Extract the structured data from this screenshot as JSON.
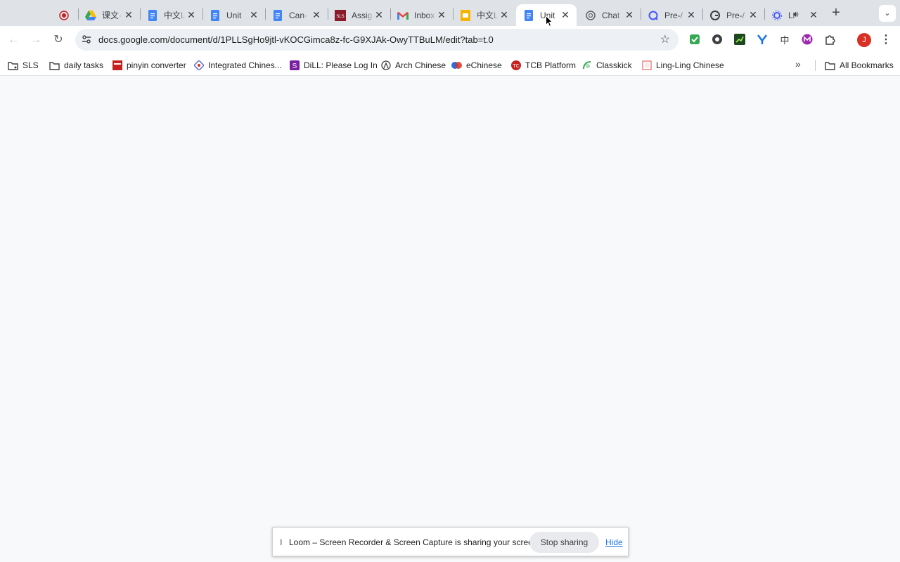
{
  "tabs": [
    {
      "title": "",
      "icon": "record-icon",
      "color": "#c5221f"
    },
    {
      "title": "课文·",
      "icon": "google-drive-icon"
    },
    {
      "title": "中文L",
      "icon": "google-docs-icon",
      "color": "#4285f4"
    },
    {
      "title": "Unit",
      "icon": "google-docs-icon",
      "color": "#4285f4"
    },
    {
      "title": "Can·",
      "icon": "google-docs-icon",
      "color": "#4285f4"
    },
    {
      "title": "Assig",
      "icon": "sls-icon",
      "color": "#8b1a2b"
    },
    {
      "title": "Inbox",
      "icon": "gmail-icon"
    },
    {
      "title": "中文L",
      "icon": "google-slides-icon",
      "color": "#f4b400"
    },
    {
      "title": "Unit",
      "icon": "google-docs-icon",
      "color": "#4285f4",
      "active": true
    },
    {
      "title": "Chat",
      "icon": "chatgpt-icon"
    },
    {
      "title": "Pre-/",
      "icon": "quizlet-icon",
      "color": "#4255ff"
    },
    {
      "title": "Pre-/",
      "icon": "grammarly-icon"
    },
    {
      "title": "Li",
      "icon": "gear-app-icon",
      "color": "#4255ff",
      "audio": true
    }
  ],
  "address_bar": {
    "url": "docs.google.com/document/d/1PLLSgHo9jtl-vKOCGimca8z-fc-G9XJAk-OwyTTBuLM/edit?tab=t.0"
  },
  "profile": {
    "initial": "J",
    "color": "#d93025"
  },
  "bookmarks": [
    {
      "label": "SLS",
      "icon": "folder-link-icon"
    },
    {
      "label": "daily tasks",
      "icon": "folder-icon"
    },
    {
      "label": "pinyin converter",
      "icon": "pinyin-icon"
    },
    {
      "label": "Integrated Chines...",
      "icon": "integrated-chinese-icon"
    },
    {
      "label": "DiLL: Please Log In",
      "icon": "dill-icon"
    },
    {
      "label": "Arch Chinese",
      "icon": "arch-chinese-icon"
    },
    {
      "label": "eChinese",
      "icon": "echinese-icon"
    },
    {
      "label": "TCB Platform",
      "icon": "tcb-icon"
    },
    {
      "label": "Classkick",
      "icon": "classkick-icon"
    },
    {
      "label": "Ling-Ling Chinese",
      "icon": "lingling-icon"
    }
  ],
  "all_bookmarks_label": "All Bookmarks",
  "share_bar": {
    "message": "Loom – Screen Recorder & Screen Capture is sharing your screen.",
    "stop_label": "Stop sharing",
    "hide_label": "Hide"
  }
}
